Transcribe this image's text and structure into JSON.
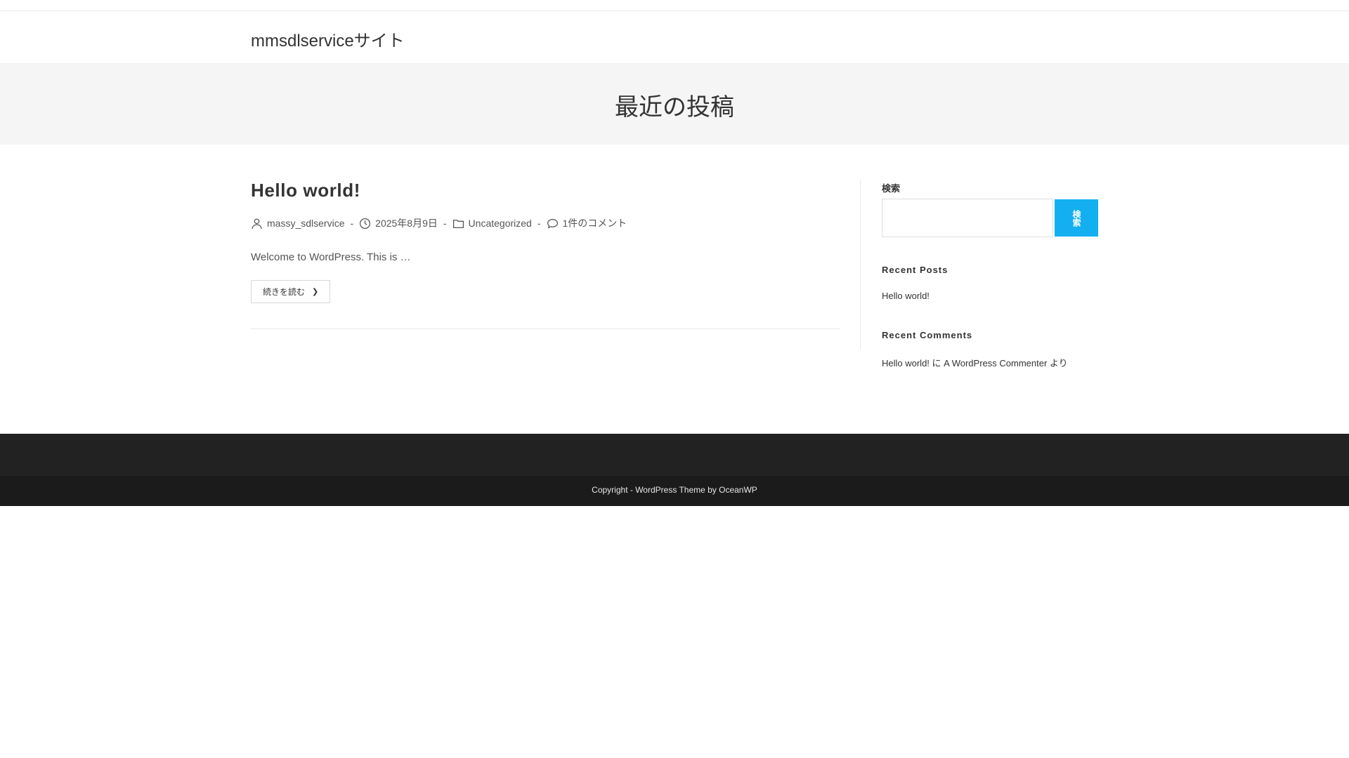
{
  "header": {
    "site_title": "mmsdlserviceサイト"
  },
  "page_header": {
    "title": "最近の投稿"
  },
  "post": {
    "title": "Hello world!",
    "author": "massy_sdlservice",
    "date": "2025年8月9日",
    "category": "Uncategorized",
    "comments": "1件のコメント",
    "separator": "-",
    "excerpt": "Welcome to WordPress. This is …",
    "read_more": "続きを読む"
  },
  "sidebar": {
    "search_label": "検索",
    "search_value": "",
    "search_button": "検索",
    "recent_posts_title": "Recent Posts",
    "recent_posts": [
      "Hello world!"
    ],
    "recent_comments_title": "Recent Comments",
    "recent_comment": "Hello world! に A WordPress Commenter より"
  },
  "footer": {
    "copyright": "Copyright - WordPress Theme by OceanWP"
  },
  "colors": {
    "accent": "#13aff0",
    "footer_bg": "#222222",
    "footer_bottom_bg": "#1b1b1b",
    "page_header_bg": "#f5f5f5"
  }
}
